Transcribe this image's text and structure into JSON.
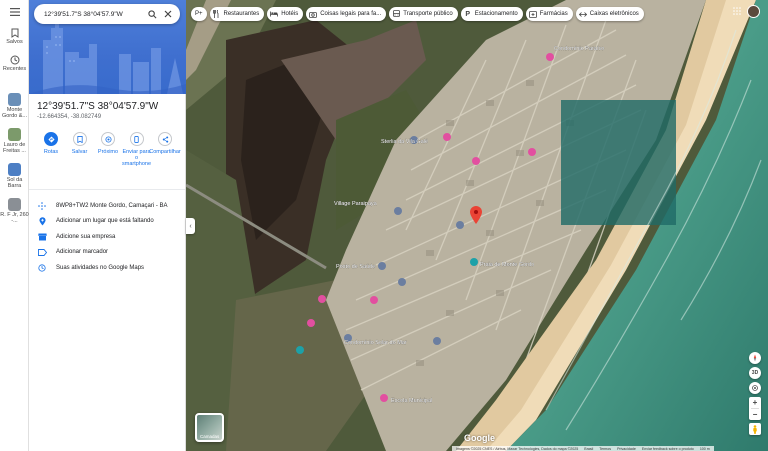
{
  "rail": {
    "items": [
      {
        "label": "Salvos",
        "icon": "bookmark-icon"
      },
      {
        "label": "Recentes",
        "icon": "history-icon"
      }
    ],
    "recents": [
      {
        "label": "Monte Gordo &...",
        "color": "#6a8fb8"
      },
      {
        "label": "Lauro de Freitas ...",
        "color": "#7c9a6b"
      },
      {
        "label": "Sol da Barra",
        "color": "#4d7fc4"
      },
      {
        "label": "R. F Jr, 260 -...",
        "color": "#8a8f95"
      }
    ]
  },
  "search": {
    "value": "12°39'51.7\"S 38°04'57.9\"W"
  },
  "place": {
    "title": "12°39'51.7\"S 38°04'57.9\"W",
    "coords": "-12.664354, -38.082749"
  },
  "actions": [
    {
      "label": "Rotas",
      "icon": "directions-icon"
    },
    {
      "label": "Salvar",
      "icon": "bookmark-icon"
    },
    {
      "label": "Próximo",
      "icon": "nearby-icon"
    },
    {
      "label": "Enviar para o smartphone",
      "icon": "phone-icon"
    },
    {
      "label": "Compartilhar",
      "icon": "share-icon"
    }
  ],
  "details": [
    {
      "text": "8WP8+TW2 Monte Gordo, Camaçari - BA",
      "icon": "plus-code-icon"
    },
    {
      "text": "Adicionar um lugar que está faltando",
      "icon": "add-place-icon"
    },
    {
      "text": "Adicione sua empresa",
      "icon": "business-icon"
    },
    {
      "text": "Adicionar marcador",
      "icon": "label-icon"
    },
    {
      "text": "Suas atividades no Google Maps",
      "icon": "history-icon"
    }
  ],
  "chips": [
    {
      "label": "P+",
      "icon": "plus-icon"
    },
    {
      "label": "Restaurantes",
      "icon": "restaurant-icon"
    },
    {
      "label": "Hotéis",
      "icon": "hotel-icon"
    },
    {
      "label": "Coisas legais para fa...",
      "icon": "camera-icon"
    },
    {
      "label": "Transporte público",
      "icon": "bus-icon"
    },
    {
      "label": "Estacionamento",
      "icon": "parking-icon"
    },
    {
      "label": "Farmácias",
      "icon": "pharmacy-icon"
    },
    {
      "label": "Caixas eletrônicos",
      "icon": "atm-icon"
    }
  ],
  "map_labels": [
    {
      "text": "Condomínio Paraíso"
    },
    {
      "text": "Sterlia da Vila Galé"
    },
    {
      "text": "Village Paraipaya"
    },
    {
      "text": "Posto de Saúde"
    },
    {
      "text": "Condomínio Solar do Mar"
    },
    {
      "text": "Praia de Monte Gordo"
    },
    {
      "text": "Escola Municipal"
    }
  ],
  "layer": {
    "label": "Camadas"
  },
  "logo": "Google",
  "footer": {
    "imagery": "Imagens ©2025 CNES / Airbus, Maxar Technologies, Dados do mapa ©2025",
    "country": "Brasil",
    "terms": "Termos",
    "privacy": "Privacidade",
    "feedback": "Enviar feedback sobre o produto",
    "scale": "100 m"
  },
  "controls": {
    "view3d": "3D"
  },
  "colors": {
    "accent": "#1a73e8",
    "pin": "#ea4335",
    "poi_pink": "#e24fa0",
    "poi_teal": "#1da1a8"
  }
}
